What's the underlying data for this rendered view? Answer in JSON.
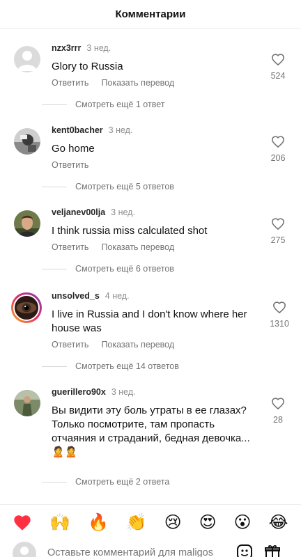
{
  "header": {
    "title": "Комментарии"
  },
  "actions": {
    "reply": "Ответить",
    "translate": "Показать перевод"
  },
  "comments": [
    {
      "username": "nzx3rrr",
      "time": "3 нед.",
      "text": "Glory to Russia",
      "likes": "524",
      "view_more": "Смотреть ещё 1 ответ"
    },
    {
      "username": "kent0bacher",
      "time": "3 нед.",
      "text": "Go home",
      "likes": "206",
      "view_more": "Смотреть ещё 5 ответов"
    },
    {
      "username": "veljanev00lja",
      "time": "3 нед.",
      "text": "I think russia miss calculated shot",
      "likes": "275",
      "view_more": "Смотреть ещё 6 ответов"
    },
    {
      "username": "unsolved_s",
      "time": "4 нед.",
      "text": "I live in Russia and I don't know where her house was",
      "likes": "1310",
      "view_more": "Смотреть ещё 14 ответов"
    },
    {
      "username": "guerillero90x",
      "time": "3 нед.",
      "text": "Вы видити эту боль утраты в ее глазах? Только посмотрите, там пропасть отчаяния и страданий, бедная девочка...🙎🙎",
      "likes": "28",
      "view_more": "Смотреть ещё 2 ответа"
    }
  ],
  "emoji_bar": [
    "❤️",
    "🙌",
    "🔥",
    "👏",
    "😢",
    "😍",
    "😮",
    "😂"
  ],
  "composer": {
    "placeholder": "Оставьте комментарий для maligos"
  },
  "colors": {
    "text": "#111111",
    "muted": "#737373",
    "divider": "#ececec",
    "heart": "#ff3040"
  }
}
